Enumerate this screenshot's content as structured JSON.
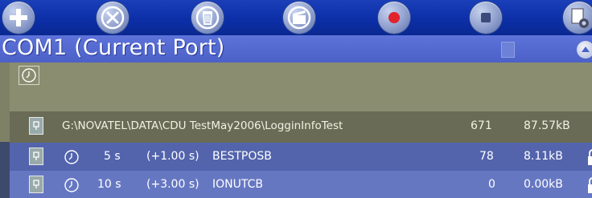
{
  "toolbar": {
    "buttons": [
      {
        "icon": "plus-icon"
      },
      {
        "icon": "close-icon"
      },
      {
        "icon": "trash-icon"
      },
      {
        "icon": "clapboard-icon"
      },
      {
        "icon": "record-icon"
      },
      {
        "icon": "stop-icon"
      },
      {
        "icon": "settings-document-icon"
      }
    ],
    "record_color": "#e0232d"
  },
  "header": {
    "title": "COM1 (Current Port)"
  },
  "log_file": {
    "path": "G:\\NOVATEL\\DATA\\CDU TestMay2006\\LogginInfoTest",
    "count": "671",
    "size": "87.57kB"
  },
  "messages": [
    {
      "period": "5 s",
      "offset": "(+1.00 s)",
      "name": "BESTPOSB",
      "count": "78",
      "size": "8.11kB"
    },
    {
      "period": "10 s",
      "offset": "(+3.00 s)",
      "name": "IONUTCB",
      "count": "0",
      "size": "0.00kB"
    }
  ]
}
